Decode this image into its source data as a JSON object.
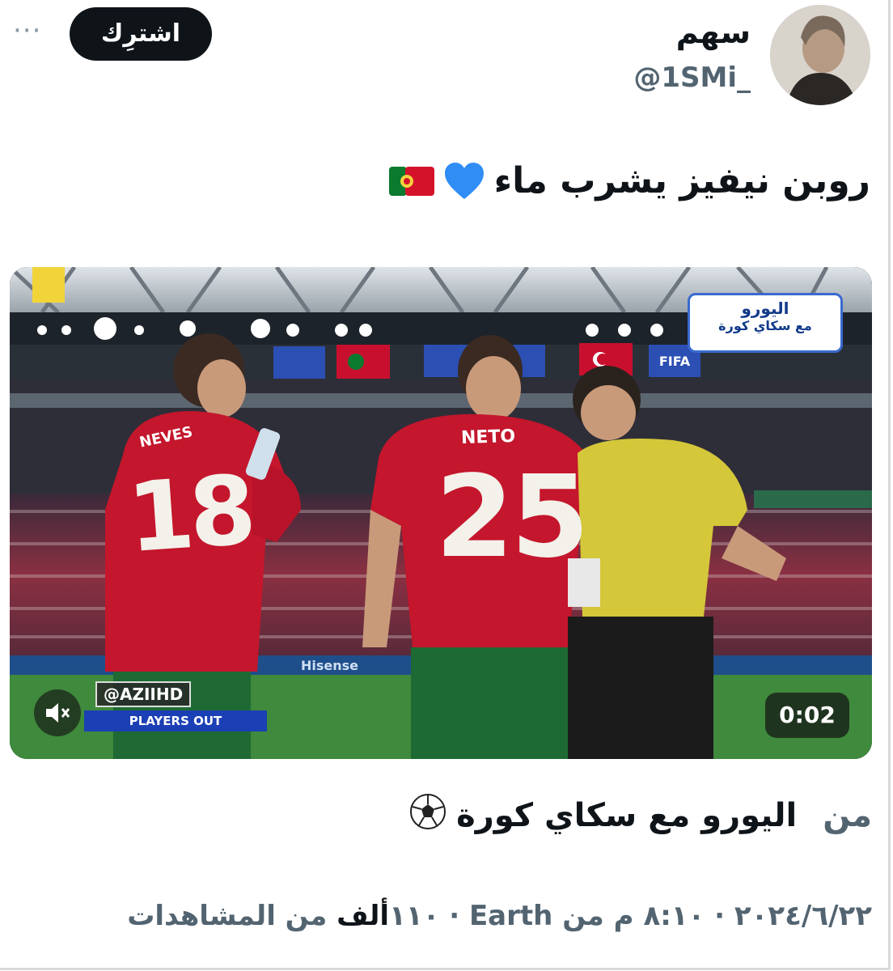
{
  "author": {
    "display_name": "سهم",
    "handle": "@1SMi_"
  },
  "header": {
    "subscribe_label": "اشترِك",
    "more_label": "···"
  },
  "tweet": {
    "text": "روبن نيفيز يشرب ماء",
    "emoji": [
      "blue-heart",
      "portugal-flag"
    ]
  },
  "video": {
    "badge_line1": "اليورو",
    "badge_line2": "مع سكاي كورة",
    "player_front_name": "NETO",
    "player_front_number": "25",
    "player_left_name": "NEVES",
    "player_left_number": "18",
    "watermark": "@AZIIHD",
    "overlay_caption": "PLAYERS OUT",
    "duration": "0:02",
    "mute_icon": "speaker-muted-icon"
  },
  "source": {
    "from_label": "من",
    "name": "اليورو مع سكاي كورة"
  },
  "meta": {
    "text": "٢٠٢٤/٦/٢٢ · ٨:١٠ م من Earth · ١١٠",
    "views": "ألف",
    "views_suffix": " من المشاهدات"
  },
  "colors": {
    "text": "#0f1419",
    "secondary": "#536471",
    "portugal_red": "#c8102e",
    "referee_yellow": "#d4c73a"
  }
}
